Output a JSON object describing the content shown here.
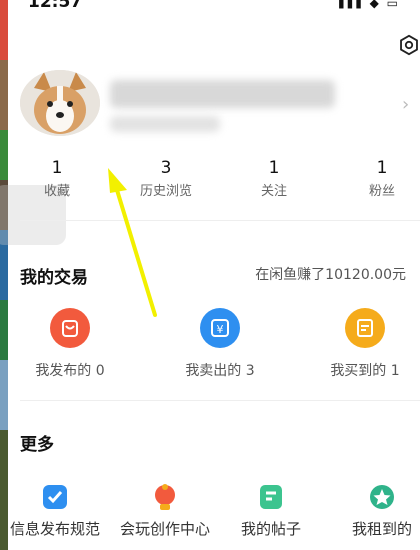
{
  "status": {
    "time": "12:57",
    "indicators": "▮▮▮ ◆ ▭"
  },
  "profile": {
    "settings_icon": "gear-icon",
    "chevron": "›"
  },
  "stats": [
    {
      "value": "1",
      "label": "收藏"
    },
    {
      "value": "3",
      "label": "历史浏览"
    },
    {
      "value": "1",
      "label": "关注"
    },
    {
      "value": "1",
      "label": "粉丝"
    }
  ],
  "trade": {
    "title": "我的交易",
    "earned": "在闲鱼赚了10120.00元",
    "items": [
      {
        "label": "我发布的 0",
        "icon": "published-bag-icon",
        "color": "#f25a3d"
      },
      {
        "label": "我卖出的 3",
        "icon": "yen-sold-icon",
        "color": "#2e8ff0"
      },
      {
        "label": "我买到的 1",
        "icon": "bought-receipt-icon",
        "color": "#f5ab1b"
      }
    ]
  },
  "more": {
    "title": "更多",
    "items": [
      {
        "label": "信息发布规范",
        "icon": "check-doc-icon",
        "color": "#2e8ff0"
      },
      {
        "label": "会玩创作中心",
        "icon": "bulb-icon",
        "color": "#f25a3d"
      },
      {
        "label": "我的帖子",
        "icon": "post-icon",
        "color": "#3cc48f"
      },
      {
        "label": "我租到的",
        "icon": "star-badge-icon",
        "color": "#2fb38a"
      }
    ]
  }
}
